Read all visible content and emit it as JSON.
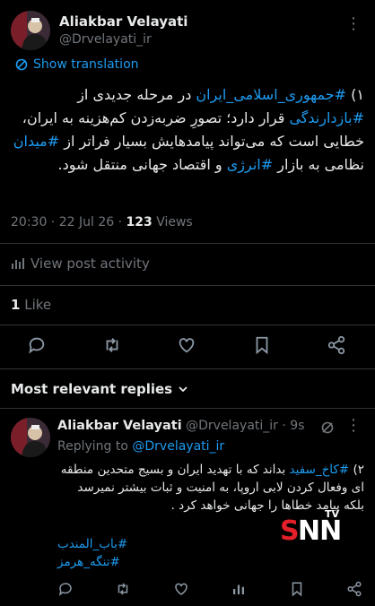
{
  "tweet": {
    "author_name": "Aliakbar Velayati",
    "author_handle": "@Drvelayati_ir",
    "more_icon": "more-dots-icon",
    "translate_label": "Show translation",
    "body_segments": [
      {
        "text": "۱) ",
        "tag": false
      },
      {
        "text": "#جمهوری_اسلامی_ایران",
        "tag": true
      },
      {
        "text": " در مرحله جدیدی از ",
        "tag": false
      },
      {
        "text": "#بازدارندگی",
        "tag": true
      },
      {
        "text": " قرار دارد؛ تصورِ ضربه‌زدن کم‌هزینه به ایران، خطایی است که می‌تواند پیامدهایش بسیار فراتر از ",
        "tag": false
      },
      {
        "text": "#میدان",
        "tag": true
      },
      {
        "text": " نظامی به بازار ",
        "tag": false
      },
      {
        "text": "#انرژی",
        "tag": true
      },
      {
        "text": " و اقتصاد جهانی منتقل شود.",
        "tag": false
      }
    ],
    "time": "20:30",
    "date": "22 Jul 26",
    "views_count": "123",
    "views_label": "Views",
    "view_activity_label": "View post activity",
    "likes_count": "1",
    "likes_label": "Like"
  },
  "replies_header": "Most relevant replies",
  "reply": {
    "author_name": "Aliakbar Velayati",
    "author_handle": "@Drvelayati_ir",
    "age": "9s",
    "replying_prefix": "Replying to",
    "replying_handle": "@Drvelayati_ir",
    "body_segments": [
      {
        "text": "۲) ",
        "tag": false
      },
      {
        "text": "#کاخ_سفید",
        "tag": true
      },
      {
        "text": " بداند که با تهدید ایران و بسیج متحدین منطقه ای وفعال کردن لابی اروپا، به امنیت و ثبات بیشتر نمیرسد بلکه پیامد خطاها را جهانی خواهد کرد .",
        "tag": false
      }
    ],
    "hashtag_1": "#باب_المندب",
    "hashtag_2": "#تنگه_هرمز"
  },
  "watermark": {
    "text": "SNN",
    "sub": "TV"
  },
  "colors": {
    "accent": "#1d9bf0",
    "muted": "#71767b",
    "background": "#000000",
    "watermark_red": "#e3202a"
  }
}
